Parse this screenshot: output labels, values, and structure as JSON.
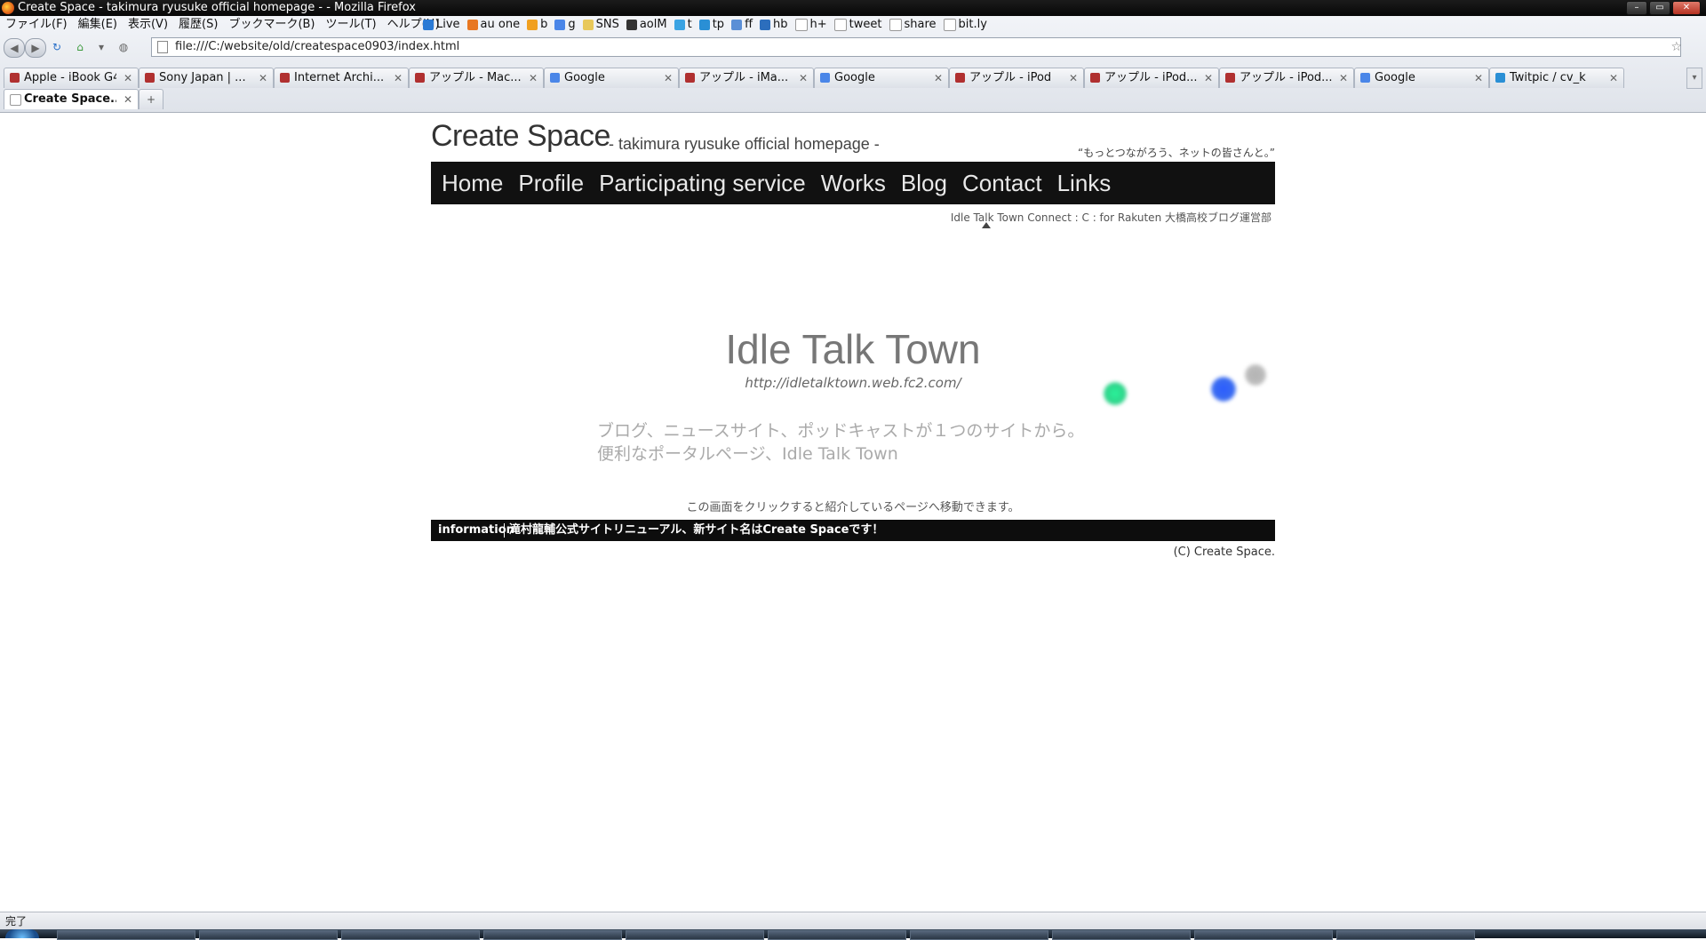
{
  "window": {
    "title": "Create Space - takimura ryusuke official homepage - - Mozilla Firefox",
    "controls": [
      "minimize",
      "maximize",
      "close"
    ]
  },
  "menubar": [
    "ファイル(F)",
    "編集(E)",
    "表示(V)",
    "履歴(S)",
    "ブックマーク(B)",
    "ツール(T)",
    "ヘルプ(H)"
  ],
  "bookmarks": [
    {
      "label": "Live",
      "icon": "windows-flag-icon",
      "color": "#2a7ad5"
    },
    {
      "label": "au one",
      "icon": "au-icon",
      "color": "#e87722"
    },
    {
      "label": "b",
      "icon": "b-icon",
      "color": "#f0a020"
    },
    {
      "label": "g",
      "icon": "google-icon",
      "color": "#4a86e8"
    },
    {
      "label": "SNS",
      "icon": "folder-icon",
      "color": "#e8c85a"
    },
    {
      "label": "aolM",
      "icon": "aol-icon",
      "color": "#333333"
    },
    {
      "label": "t",
      "icon": "twitter-icon",
      "color": "#3aa3e3"
    },
    {
      "label": "tp",
      "icon": "twitpic-icon",
      "color": "#2a8fd5"
    },
    {
      "label": "ff",
      "icon": "friendfeed-icon",
      "color": "#5b8fd6"
    },
    {
      "label": "hb",
      "icon": "hatena-bookmark-icon",
      "color": "#2c6ebd"
    },
    {
      "label": "h+",
      "icon": "page-icon",
      "color": "#ffffff"
    },
    {
      "label": "tweet",
      "icon": "page-icon",
      "color": "#ffffff"
    },
    {
      "label": "share",
      "icon": "page-icon",
      "color": "#ffffff"
    },
    {
      "label": "bit.ly",
      "icon": "page-icon",
      "color": "#ffffff"
    }
  ],
  "address": {
    "url": "file:///C:/website/old/createspace0903/index.html"
  },
  "tabs": [
    {
      "label": "Apple - iBook G4",
      "icon": "apple-site-icon",
      "color": "#b03030"
    },
    {
      "label": "Sony Japan | ...",
      "icon": "apple-site-icon",
      "color": "#b03030"
    },
    {
      "label": "Internet Archi...",
      "icon": "apple-site-icon",
      "color": "#b03030"
    },
    {
      "label": "アップル - Mac...",
      "icon": "apple-site-icon",
      "color": "#b03030"
    },
    {
      "label": "Google",
      "icon": "google-icon",
      "color": "#4a86e8"
    },
    {
      "label": "アップル - iMa...",
      "icon": "apple-site-icon",
      "color": "#b03030"
    },
    {
      "label": "Google",
      "icon": "google-icon",
      "color": "#4a86e8"
    },
    {
      "label": "アップル - iPod",
      "icon": "apple-site-icon",
      "color": "#b03030"
    },
    {
      "label": "アップル - iPod...",
      "icon": "apple-site-icon",
      "color": "#b03030"
    },
    {
      "label": "アップル - iPod...",
      "icon": "apple-site-icon",
      "color": "#b03030"
    },
    {
      "label": "Google",
      "icon": "google-icon",
      "color": "#4a86e8"
    },
    {
      "label": "Twitpic / cv_k",
      "icon": "twitpic-icon",
      "color": "#2a8fd5"
    }
  ],
  "active_tab": {
    "label": "Create Space...",
    "icon": "page-icon"
  },
  "site": {
    "logo": "Create Space",
    "logo_sub": "- takimura ryusuke official homepage -",
    "tagline": "“もっとつながろう、ネットの皆さんと。”",
    "nav": [
      "Home",
      "Profile",
      "Participating service",
      "Works",
      "Blog",
      "Contact",
      "Links"
    ],
    "subnav": "Idle Talk Town  Connect : C : for Rakuten 大橋高校ブログ運営部",
    "feature": {
      "title": "Idle Talk Town",
      "url": "http://idletalktown.web.fc2.com/",
      "desc_line1": "ブログ、ニュースサイト、ポッドキャストが１つのサイトから。",
      "desc_line2": "便利なポータルページ、Idle Talk Town"
    },
    "click_note": "この画面をクリックすると紹介しているページへ移動できます。",
    "info_label": "information",
    "info_text": "滝村龍輔公式サイトリニューアル、新サイト名はCreate Spaceです！",
    "copyright": "(C) Create Space."
  },
  "status": {
    "text": "完了"
  }
}
